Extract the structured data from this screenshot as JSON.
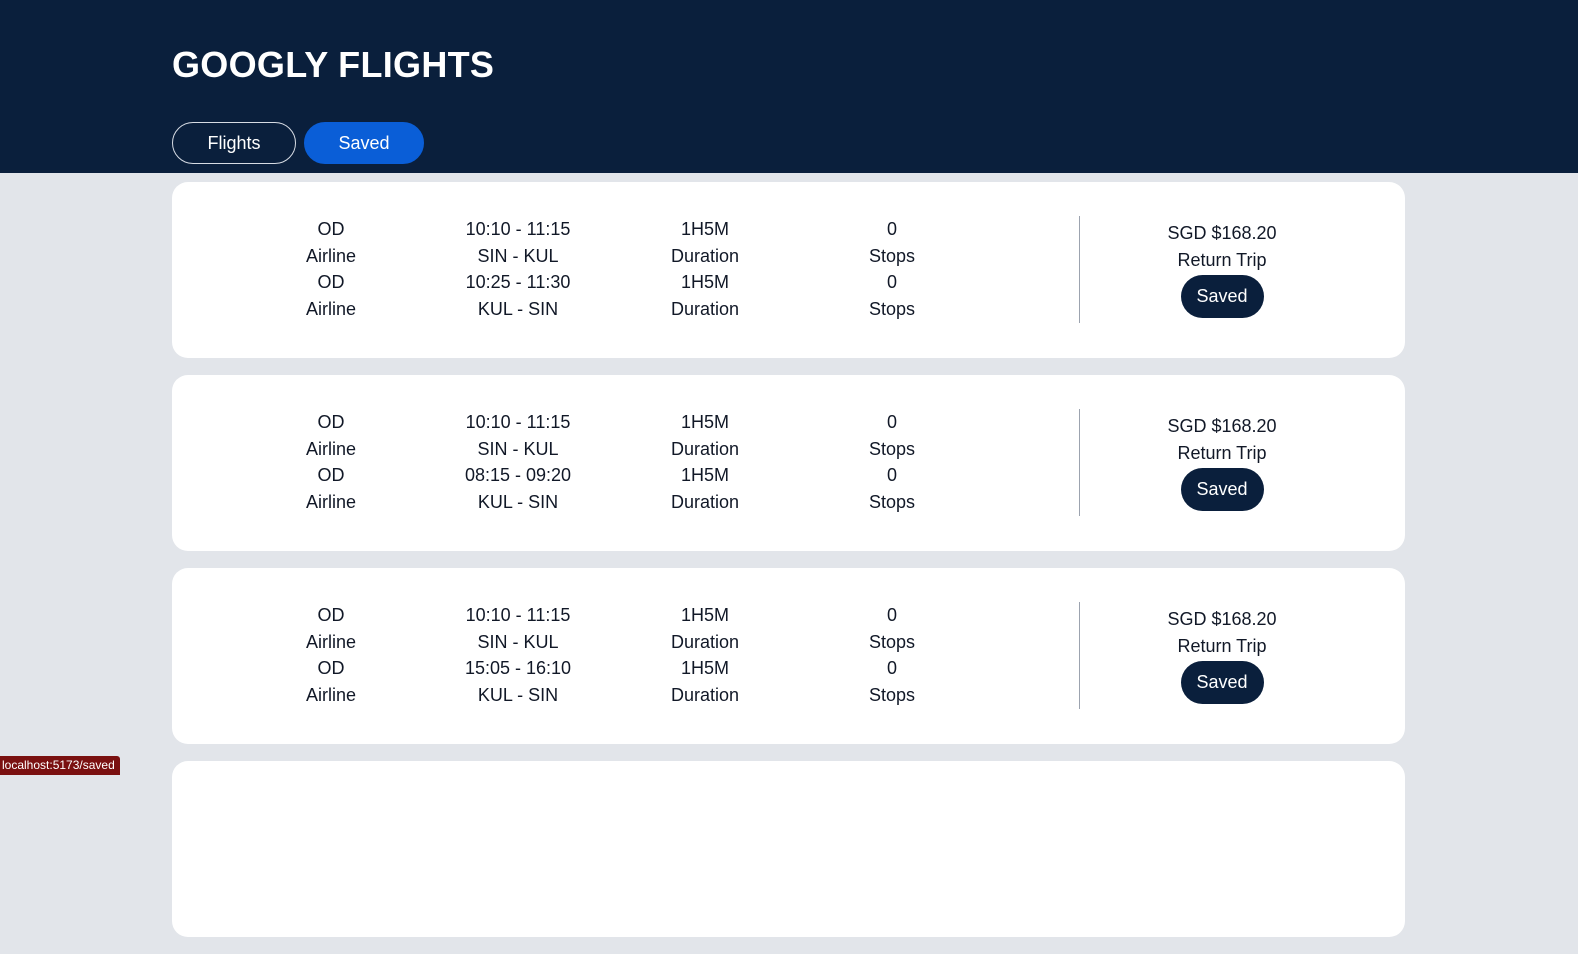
{
  "app": {
    "title": "GOOGLY FLIGHTS"
  },
  "nav": {
    "flights_label": "Flights",
    "saved_label": "Saved",
    "active": "Saved"
  },
  "colors": {
    "header_bg": "#0a1f3c",
    "accent": "#0a5ed7",
    "page_bg": "#e2e5ea"
  },
  "cards": [
    {
      "outbound": {
        "airline": "OD",
        "airline_label": "Airline",
        "time": "10:10 - 11:15",
        "route": "SIN - KUL",
        "duration": "1H5M",
        "duration_label": "Duration",
        "stops": "0",
        "stops_label": "Stops"
      },
      "return": {
        "airline": "OD",
        "airline_label": "Airline",
        "time": "10:25 - 11:30",
        "route": "KUL - SIN",
        "duration": "1H5M",
        "duration_label": "Duration",
        "stops": "0",
        "stops_label": "Stops"
      },
      "price": "SGD $168.20",
      "trip_type": "Return Trip",
      "save_label": "Saved"
    },
    {
      "outbound": {
        "airline": "OD",
        "airline_label": "Airline",
        "time": "10:10 - 11:15",
        "route": "SIN - KUL",
        "duration": "1H5M",
        "duration_label": "Duration",
        "stops": "0",
        "stops_label": "Stops"
      },
      "return": {
        "airline": "OD",
        "airline_label": "Airline",
        "time": "08:15 - 09:20",
        "route": "KUL - SIN",
        "duration": "1H5M",
        "duration_label": "Duration",
        "stops": "0",
        "stops_label": "Stops"
      },
      "price": "SGD $168.20",
      "trip_type": "Return Trip",
      "save_label": "Saved"
    },
    {
      "outbound": {
        "airline": "OD",
        "airline_label": "Airline",
        "time": "10:10 - 11:15",
        "route": "SIN - KUL",
        "duration": "1H5M",
        "duration_label": "Duration",
        "stops": "0",
        "stops_label": "Stops"
      },
      "return": {
        "airline": "OD",
        "airline_label": "Airline",
        "time": "15:05 - 16:10",
        "route": "KUL - SIN",
        "duration": "1H5M",
        "duration_label": "Duration",
        "stops": "0",
        "stops_label": "Stops"
      },
      "price": "SGD $168.20",
      "trip_type": "Return Trip",
      "save_label": "Saved"
    }
  ],
  "status_bar": {
    "url": "localhost:5173/saved"
  }
}
